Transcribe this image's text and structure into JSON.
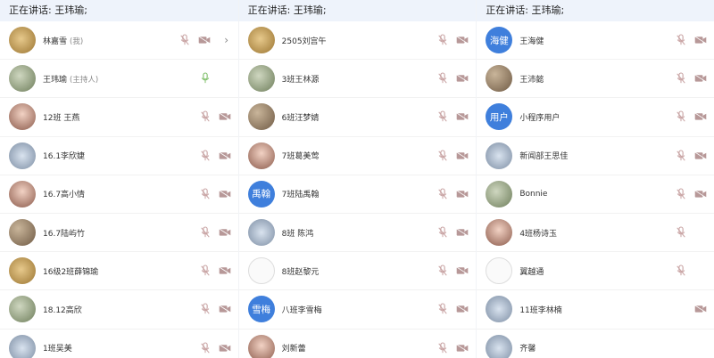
{
  "colors": {
    "speaking_bar_bg": "#eef3fb",
    "text_avatar_bg": "#3f7fdc",
    "mic_muted": "#c8a3a3",
    "mic_active": "#7fbf6a",
    "cam_muted": "#b79898"
  },
  "columns": [
    {
      "speaking_label": "正在讲话: 王玮瑜;",
      "rows": [
        {
          "name": "林嘉雪",
          "tag": "(我)",
          "avatar": "photo5",
          "mic": "muted",
          "cam": true,
          "chevron": true
        },
        {
          "name": "王玮瑜",
          "tag": "(主持人)",
          "avatar": "photo2",
          "mic": "active",
          "cam": false
        },
        {
          "name": "12班 王燕",
          "avatar": "photo3",
          "mic": "muted",
          "cam": true
        },
        {
          "name": "16.1李欣婕",
          "avatar": "photo4",
          "mic": "muted",
          "cam": true
        },
        {
          "name": "16.7高小情",
          "avatar": "photo3",
          "mic": "muted",
          "cam": true
        },
        {
          "name": "16.7陆屿竹",
          "avatar": "photo",
          "mic": "muted",
          "cam": true
        },
        {
          "name": "16级2班薛锦瑜",
          "avatar": "photo5",
          "mic": "muted",
          "cam": true
        },
        {
          "name": "18.12高欣",
          "avatar": "photo2",
          "mic": "muted",
          "cam": true
        },
        {
          "name": "1班吴美",
          "avatar": "photo4",
          "mic": "muted",
          "cam": true
        }
      ]
    },
    {
      "speaking_label": "正在讲话: 王玮瑜;",
      "rows": [
        {
          "name": "2505刘宫午",
          "avatar": "photo5",
          "mic": "muted",
          "cam": true
        },
        {
          "name": "3班王林源",
          "avatar": "photo2",
          "mic": "muted",
          "cam": true
        },
        {
          "name": "6班汪梦婧",
          "avatar": "photo",
          "mic": "muted",
          "cam": true
        },
        {
          "name": "7班葛美莺",
          "avatar": "photo3",
          "mic": "muted",
          "cam": true
        },
        {
          "name": "7班陆禹翰",
          "avatar": "text",
          "avatar_text": "禹翰",
          "mic": "muted",
          "cam": true
        },
        {
          "name": "8班 陈鸿",
          "avatar": "photo4",
          "mic": "muted",
          "cam": true
        },
        {
          "name": "8班赵黎元",
          "avatar": "ghost",
          "mic": "muted",
          "cam": true
        },
        {
          "name": "八班李雪梅",
          "avatar": "text",
          "avatar_text": "雪梅",
          "mic": "muted",
          "cam": true
        },
        {
          "name": "刘新蕾",
          "avatar": "photo3",
          "mic": "muted",
          "cam": true
        }
      ]
    },
    {
      "speaking_label": "正在讲话: 王玮瑜;",
      "rows": [
        {
          "name": "王海健",
          "avatar": "text",
          "avatar_text": "海健",
          "mic": "muted",
          "cam": true
        },
        {
          "name": "王沛懿",
          "avatar": "photo",
          "mic": "muted",
          "cam": true
        },
        {
          "name": "小程序用户",
          "avatar": "text",
          "avatar_text": "用户",
          "mic": "muted",
          "cam": true
        },
        {
          "name": "新闻部王思佳",
          "avatar": "photo4",
          "mic": "muted",
          "cam": true
        },
        {
          "name": "Bonnie",
          "avatar": "photo2",
          "mic": "muted",
          "cam": true
        },
        {
          "name": "4班杨诗玉",
          "avatar": "photo3",
          "mic": "muted",
          "cam": false
        },
        {
          "name": "翼越通",
          "avatar": "ghost",
          "mic": "muted",
          "cam": false
        },
        {
          "name": "11班李林楠",
          "avatar": "photo4",
          "mic": "none",
          "cam": true
        },
        {
          "name": "齐馨",
          "avatar": "photo4",
          "mic": "none",
          "cam": false
        }
      ]
    }
  ]
}
